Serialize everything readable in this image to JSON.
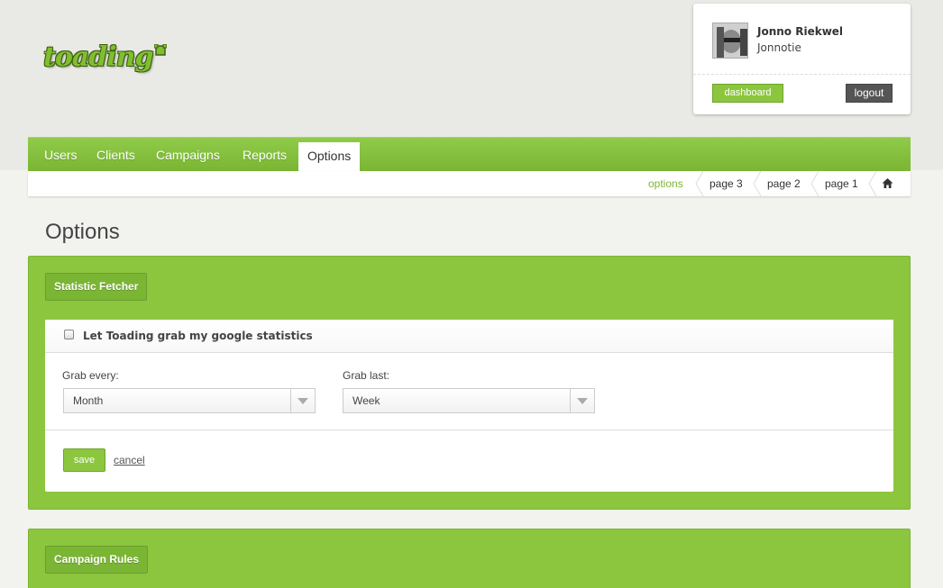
{
  "brand": {
    "logo_text": "toading"
  },
  "user": {
    "name": "Jonno Riekwel",
    "handle": "Jonnotie",
    "dashboard_label": "dashboard",
    "logout_label": "logout"
  },
  "nav": {
    "items": [
      {
        "label": "Users"
      },
      {
        "label": "Clients"
      },
      {
        "label": "Campaigns"
      },
      {
        "label": "Reports"
      },
      {
        "label": "Options"
      }
    ],
    "active": "Options"
  },
  "breadcrumb": {
    "items": [
      {
        "label": "options"
      },
      {
        "label": "page 3"
      },
      {
        "label": "page 2"
      },
      {
        "label": "page 1"
      }
    ],
    "home_icon": "home-icon"
  },
  "page": {
    "title": "Options"
  },
  "statistic_fetcher": {
    "tab_label": "Statistic Fetcher",
    "checkbox_label": "Let Toading grab my google statistics",
    "checkbox_checked": false,
    "grab_every_label": "Grab every:",
    "grab_every_value": "Month",
    "grab_last_label": "Grab last:",
    "grab_last_value": "Week",
    "save_label": "save",
    "cancel_label": "cancel"
  },
  "campaign_rules": {
    "tab_label": "Campaign Rules"
  },
  "colors": {
    "accent": "#8cc63f",
    "accent_dark": "#7ab534",
    "logout_bg": "#555555"
  }
}
